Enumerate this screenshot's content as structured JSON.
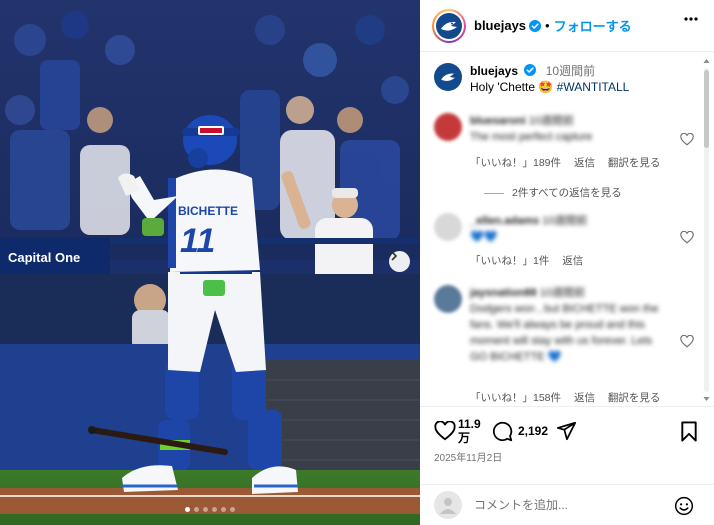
{
  "post": {
    "username": "bluejays",
    "follow_label": "フォローする",
    "separator": "•",
    "caption_text": "Holy 'Chette",
    "caption_emoji": "🤩",
    "hashtag": "#WANTITALL",
    "time_ago": "10週間前",
    "likes_count": "11.9",
    "likes_unit": "万",
    "comments_count": "2,192",
    "date": "2025年11月2日"
  },
  "photo": {
    "jersey_name": "BICHETTE",
    "jersey_number": "11",
    "ad_text": "Capital One",
    "slide_count": 6,
    "active_slide": 0
  },
  "comments": [
    {
      "username_blurred": "bluesaroni",
      "time_blurred": "10週間前",
      "text_blurred": "The most perfect capture",
      "like_label": "「いいね！」189件",
      "reply_label": "返信",
      "translate_label": "翻訳を見る",
      "replies_label": "2件すべての返信を見る"
    },
    {
      "username_blurred": "_ellen.adams",
      "time_blurred": "10週間前",
      "text_blurred": "💙💙",
      "like_label": "「いいね！」1件",
      "reply_label": "返信"
    },
    {
      "username_blurred": "jaysnation88",
      "time_blurred": "10週間前",
      "text_blurred": "Dodgers won , but BICHETTE won the fans. We'll always be proud and this moment will stay with us forever. Lets GO BICHETTE 💙",
      "like_label": "「いいね！」158件",
      "reply_label": "返信",
      "translate_label": "翻訳を見る"
    }
  ],
  "composer": {
    "placeholder": "コメントを追加..."
  },
  "colors": {
    "accent": "#0095f6",
    "hashtag": "#00376b",
    "jays_blue": "#134a8e"
  },
  "icons": {
    "verified": "verified-badge-icon",
    "more": "more-horizontal-icon",
    "like": "heart-icon",
    "comment": "comment-bubble-icon",
    "share": "paper-plane-icon",
    "save": "bookmark-icon",
    "emoji": "smiley-icon",
    "next": "chevron-right-icon"
  }
}
